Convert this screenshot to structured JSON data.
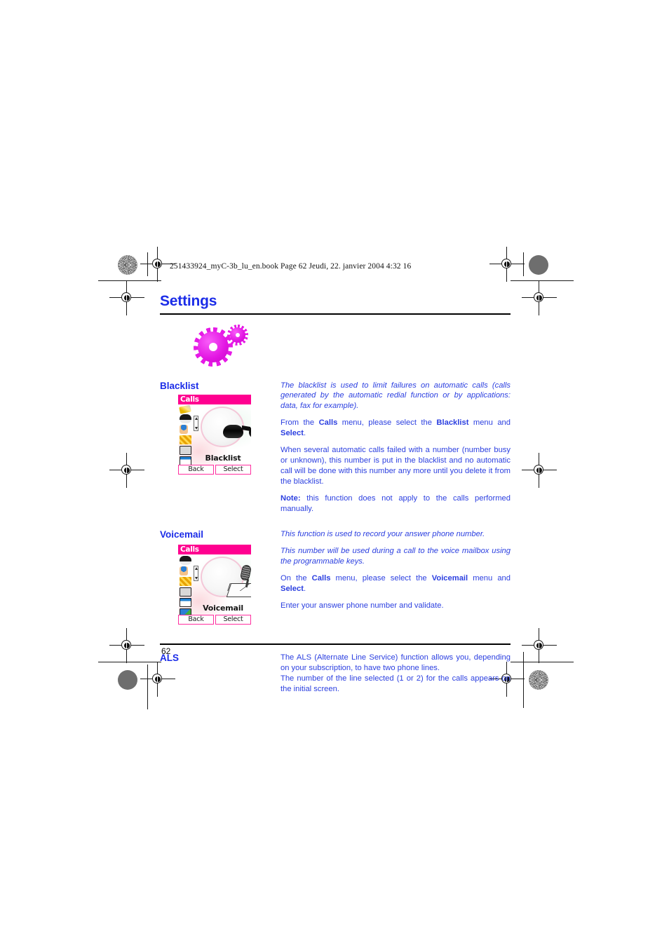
{
  "slug": "251433924_myC-3b_lu_en.book  Page 62  Jeudi, 22. janvier 2004  4:32 16",
  "chapter": {
    "title": "Settings"
  },
  "colors": {
    "heading_blue": "#1b2ce8",
    "body_blue": "#2b3fe0",
    "magenta": "#ff0090",
    "gear_magenta": "#e215e2"
  },
  "sections": [
    {
      "heading": "Blacklist",
      "paragraphs": [
        {
          "style": "italic",
          "text": "The blacklist is used to limit failures on automatic calls (calls generated by the automatic redial function or by applications: data, fax for example)."
        },
        {
          "style": "rich",
          "parts": [
            {
              "text": "From the ",
              "bold": false
            },
            {
              "text": "Calls",
              "bold": true
            },
            {
              "text": " menu, please select the ",
              "bold": false
            },
            {
              "text": "Blacklist",
              "bold": true
            },
            {
              "text": " menu and ",
              "bold": false
            },
            {
              "text": "Select",
              "bold": true
            },
            {
              "text": ".",
              "bold": false
            }
          ]
        },
        {
          "style": "plain",
          "text": "When several automatic calls failed with a number (number busy or unknown), this number is put in the blacklist and no automatic call will be done with this number any more until you delete it from the blacklist."
        },
        {
          "style": "rich",
          "parts": [
            {
              "text": "Note:",
              "bold": true
            },
            {
              "text": " this function does not apply to the calls performed manually.",
              "bold": false
            }
          ]
        }
      ],
      "screenshot": {
        "title": "Calls",
        "label": "Blacklist",
        "softkeys": [
          "Back",
          "Select"
        ],
        "big_icon": "sunglasses-icon",
        "menu_icons": [
          "pencil-icon",
          "sunglasses-icon",
          "person-icon",
          "network-icon",
          "keypad-icon",
          "calendar-icon"
        ]
      }
    },
    {
      "heading": "Voicemail",
      "paragraphs": [
        {
          "style": "italic",
          "text": "This function is used to record your answer phone number."
        },
        {
          "style": "italic",
          "text": "This number will be used during a call to the voice mailbox using the programmable keys."
        },
        {
          "style": "rich",
          "parts": [
            {
              "text": "On the ",
              "bold": false
            },
            {
              "text": "Calls",
              "bold": true
            },
            {
              "text": " menu, please select the ",
              "bold": false
            },
            {
              "text": "Voicemail",
              "bold": true
            },
            {
              "text": " menu and ",
              "bold": false
            },
            {
              "text": "Select",
              "bold": true
            },
            {
              "text": ".",
              "bold": false
            }
          ]
        },
        {
          "style": "plain",
          "text": "Enter your answer phone number and validate."
        }
      ],
      "screenshot": {
        "title": "Calls",
        "label": "Voicemail",
        "softkeys": [
          "Back",
          "Select"
        ],
        "big_icon": "microphone-envelope-icon",
        "menu_icons": [
          "sunglasses-icon",
          "person-icon",
          "network-icon",
          "keypad-icon",
          "calendar-icon",
          "mailbox-icon"
        ]
      }
    },
    {
      "heading": "ALS",
      "paragraphs": [
        {
          "style": "plain",
          "text": "The ALS (Alternate Line Service) function allows you, depending on your subscription, to have two phone lines."
        },
        {
          "style": "plain",
          "text": "The number of the line selected (1 or 2) for the calls appears on the initial screen."
        }
      ],
      "screenshot": null
    }
  ],
  "footer": {
    "page_number": "62"
  }
}
